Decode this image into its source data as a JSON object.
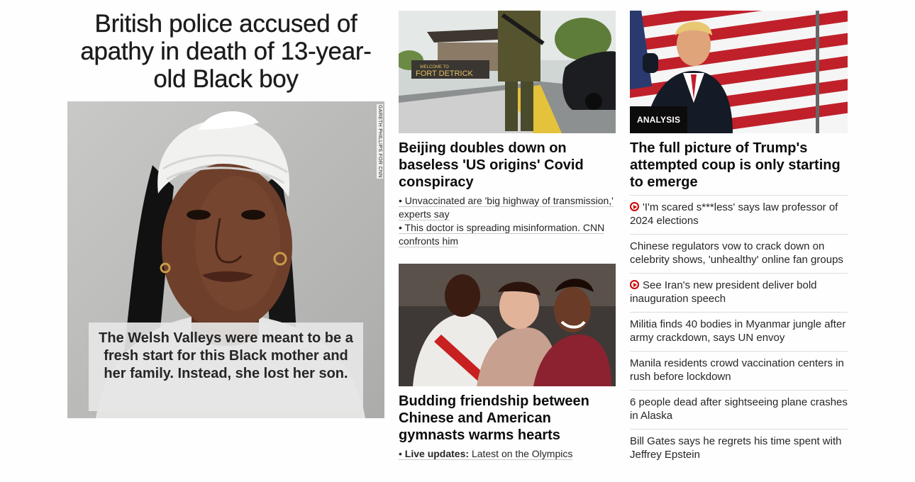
{
  "lead": {
    "title": "British police accused of apathy in death of 13-year-old Black boy",
    "photo_credit": "GARETH PHILLIPS FOR CNN",
    "caption": "The Welsh Valleys were meant to be a fresh start for this Black mother and her family. Instead, she lost her son."
  },
  "story1": {
    "headline": "Beijing doubles down on baseless 'US origins' Covid conspiracy",
    "sign_text": "WELCOME TO FORT DETRICK",
    "links": [
      "• Unvaccinated are 'big highway of transmission,' experts say",
      "• This doctor is spreading misinformation. CNN confronts him"
    ]
  },
  "story2": {
    "headline": "Budding friendship between Chinese and American gymnasts warms hearts",
    "live_label": "Live updates:",
    "live_text": "Latest on the Olympics"
  },
  "story3": {
    "badge": "ANALYSIS",
    "headline": "The full picture of Trump's attempted coup is only starting to emerge"
  },
  "list": [
    {
      "text": "'I'm scared s***less' says law professor of 2024 elections",
      "video": true
    },
    {
      "text": "Chinese regulators vow to crack down on celebrity shows, 'unhealthy' online fan groups",
      "video": false
    },
    {
      "text": "See Iran's new president deliver bold inauguration speech",
      "video": true
    },
    {
      "text": "Militia finds 40 bodies in Myanmar jungle after army crackdown, says UN envoy",
      "video": false
    },
    {
      "text": "Manila residents crowd vaccination centers in rush before lockdown",
      "video": false
    },
    {
      "text": "6 people dead after sightseeing plane crashes in Alaska",
      "video": false
    },
    {
      "text": "Bill Gates says he regrets his time spent with Jeffrey Epstein",
      "video": false
    }
  ],
  "colors": {
    "video_icon": "#cc0000",
    "badge_bg": "#0c0c0c"
  }
}
